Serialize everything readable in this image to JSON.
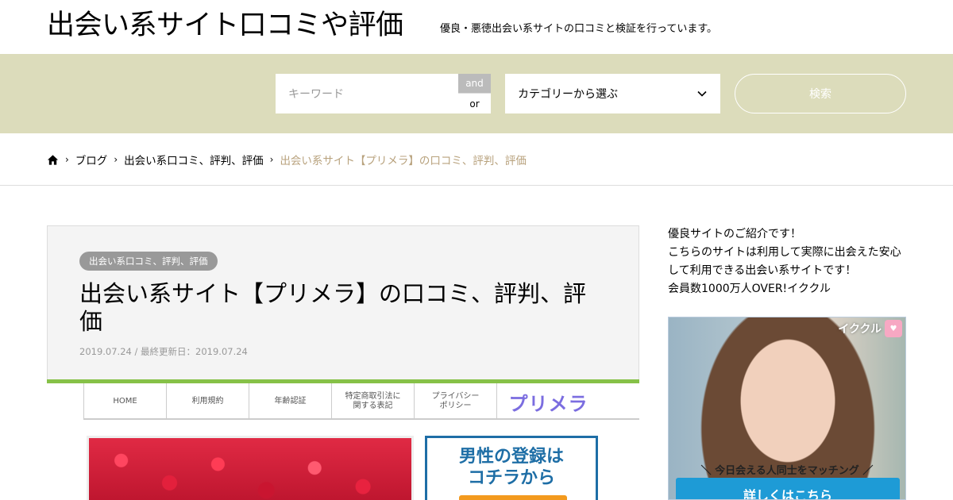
{
  "header": {
    "site_title": "出会い系サイト口コミや評価",
    "site_description": "優良・悪徳出会い系サイトの口コミと検証を行っています。"
  },
  "search": {
    "keyword_placeholder": "キーワード",
    "and_label": "and",
    "or_label": "or",
    "category_selected": "カテゴリーから選ぶ",
    "submit_label": "検索"
  },
  "breadcrumb": {
    "items": [
      "ブログ",
      "出会い系口コミ、評判、評価"
    ],
    "current": "出会い系サイト【プリメラ】の口コミ、評判、評価"
  },
  "article": {
    "category": "出会い系口コミ、評判、評価",
    "title": "出会い系サイト【プリメラ】の口コミ、評判、評価",
    "date": "2019.07.24 / 最終更新日：2019.07.24",
    "embed_nav": [
      "HOME",
      "利用規約",
      "年齢認証",
      "特定商取引法に\n関する表記",
      "プライバシー\nポリシー"
    ],
    "embed_logo": "プリメラ",
    "embed_register": "男性の登録は\nコチラから"
  },
  "sidebar": {
    "lines": [
      "優良サイトのご紹介です！",
      "こちらのサイトは利用して実際に出会えた安心",
      "して利用できる出会い系サイトです！",
      "会員数1000万人OVER!イククル"
    ],
    "ad_brand": "イククル",
    "ad_tagline": "＼ 今日会える人同士をマッチング ／",
    "ad_cta": "詳しくはこちら"
  },
  "colors": {
    "search_band": "#dcdcbb",
    "breadcrumb_current": "#b8a27d",
    "accent_green": "#86c148",
    "embed_logo": "#7b6de0",
    "cta_blue": "#1e9bd6"
  }
}
